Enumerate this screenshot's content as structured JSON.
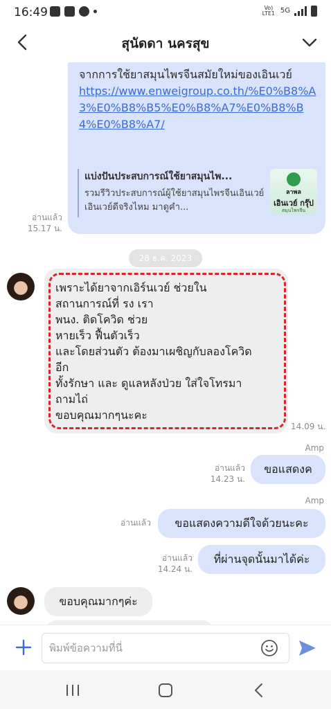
{
  "status_bar": {
    "time": "16:49",
    "network": "Vo) LTE1",
    "network_type": "5G"
  },
  "header": {
    "title": "สุนัดดา นครสุข"
  },
  "messages": {
    "link_message": {
      "text": "จากการใช้ยาสมุนไพรจีนสมัยใหม่ของเอินเวย์",
      "url": "https://www.enweigroup.co.th/%E0%B8%A3%E0%B8%B5%E0%B8%A7%E0%B8%B4%E0%B8%A7/",
      "preview_title": "แบ่งปันประสบการณ์ใช้ยาสมุนไพ...",
      "preview_desc": "รวมรีวิวประสบการณ์ผู้ใช้ยาสมุนไพรจีนเอินเวย์ เอินเวย์ดีจริงไหม มาดูคำ...",
      "thumb_brand": "ลาพล",
      "thumb_name": "เอินเวย์ กรุ๊ป",
      "thumb_tagline": "สมุนไพรจีน สร้างสรรค์",
      "read": "อ่านแล้ว",
      "time": "15.17 น."
    },
    "date_separator": "28 ธ.ค. 2023",
    "incoming_long": {
      "lines": [
        "เพราะได้ยาจากเอิร์นเวย์ ช่วยใน",
        "สถานการณ์ที่ รง เรา",
        "พนง. ติดโควิด ช่วย",
        "หายเร็ว ฟื้นตัวเร็ว",
        "และโดยส่วนตัว  ต้องมาเผชิญกับลองโควิด",
        "อีก",
        "ทั้งรักษา และ ดูแลหลังป่วย ใส่ใจโทรมา",
        "ถามไถ่",
        "ขอบคุณมากๆนะคะ"
      ],
      "time": "14.09 น."
    },
    "outgoing_1": {
      "sender": "Amp",
      "text": "ขอแสดงค",
      "read": "อ่านแล้ว",
      "time": "14.23 น."
    },
    "outgoing_2": {
      "sender": "Amp",
      "text": "ขอแสดงความดีใจด้วยนะคะ",
      "read": "อ่านแล้ว"
    },
    "outgoing_3": {
      "text": "ที่ผ่านจุดนั้นมาได้ค่ะ",
      "read": "อ่านแล้ว",
      "time": "14.24 น."
    },
    "incoming_short": {
      "text": "ขอบคุณมากๆค่ะ"
    }
  },
  "input": {
    "placeholder": "พิมพ์ข้อความที่นี่"
  },
  "colors": {
    "outgoing_bubble": "#d9e3fb",
    "incoming_bubble": "#eeeeee",
    "highlight": "#d7262e",
    "link": "#3a6bd6",
    "send": "#6b8fd8"
  }
}
